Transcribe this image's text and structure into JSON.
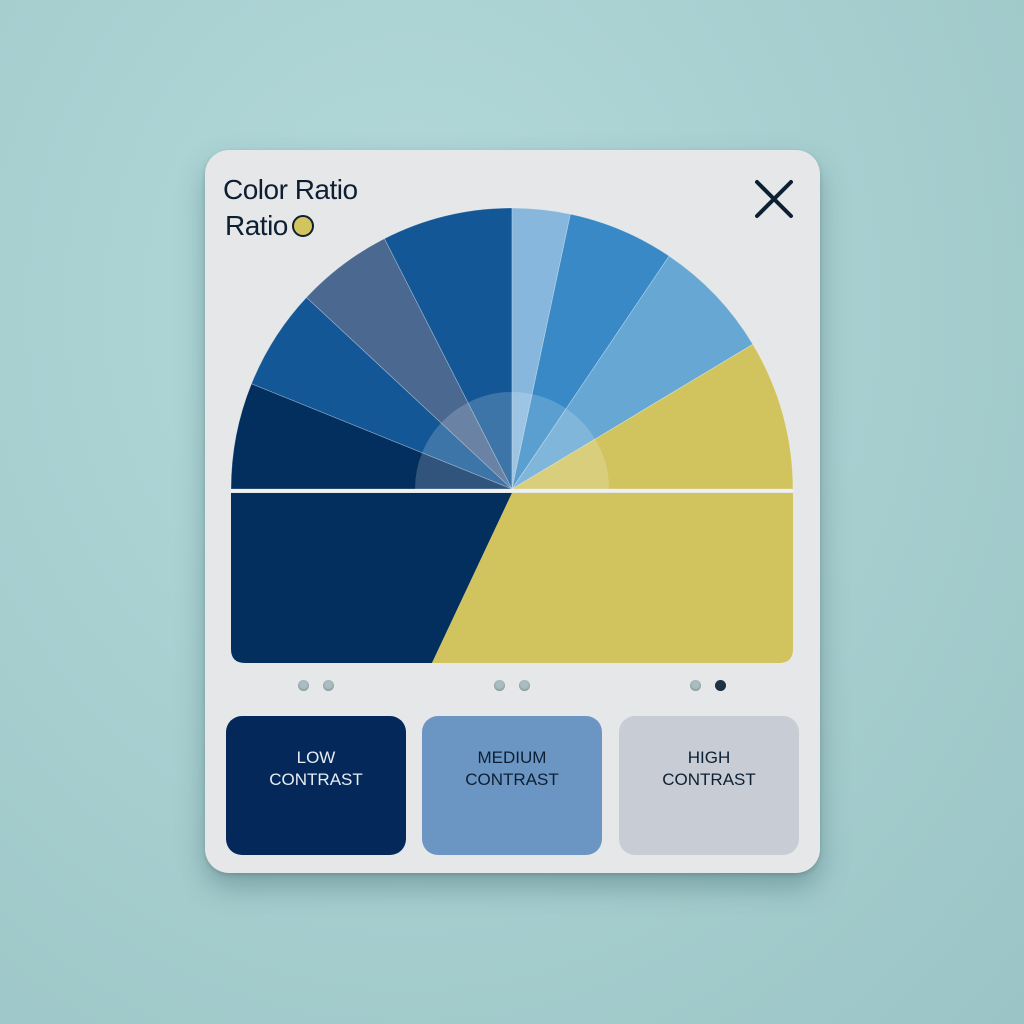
{
  "card": {
    "title": "Color Ratio",
    "subtitle": "Ratio",
    "subtitle_dot_color": "#d3c55d",
    "close_icon": "close-x-icon"
  },
  "chart_data": {
    "type": "pie",
    "shape": "semicircle",
    "unit": "degrees",
    "slices": [
      {
        "value": 22,
        "color": "#032f5e"
      },
      {
        "value": 21,
        "color": "#135797"
      },
      {
        "value": 20,
        "color": "#4a6890"
      },
      {
        "value": 27,
        "color": "#135797"
      },
      {
        "value": 12,
        "color": "#88b7dd"
      },
      {
        "value": 22,
        "color": "#3889c6"
      },
      {
        "value": 25,
        "color": "#66a7d4"
      },
      {
        "value": 31,
        "color": "#d1c45e"
      }
    ],
    "lower_split": {
      "left_color": "#032f5e",
      "right_color": "#d1c45e"
    }
  },
  "pagers": [
    {
      "active": [
        false,
        false
      ]
    },
    {
      "active": [
        false,
        false
      ]
    },
    {
      "active": [
        false,
        true
      ]
    }
  ],
  "options": [
    {
      "line1": "LOW",
      "line2": "CONTRAST",
      "bg": "#04285a",
      "fg": "#e8edf3"
    },
    {
      "line1": "MEDIUM",
      "line2": "CONTRAST",
      "bg": "#6b96c3",
      "fg": "#0d1f33"
    },
    {
      "line1": "HIGH",
      "line2": "CONTRAST",
      "bg": "#c8ccd4",
      "fg": "#0d1f33"
    }
  ]
}
